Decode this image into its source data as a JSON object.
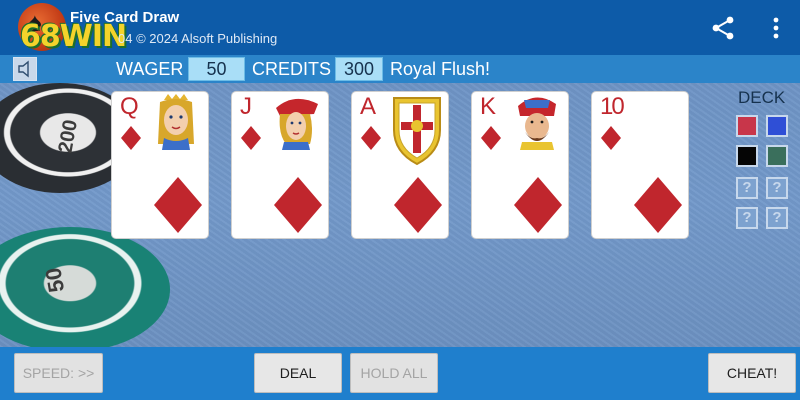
{
  "header": {
    "title": "Five Card Draw",
    "subtitle": "04 © 2024 Alsoft Publishing",
    "brand_watermark": "68WIN",
    "share_icon": "share-icon",
    "menu_icon": "more-vert-icon"
  },
  "info": {
    "sound_icon": "sound-off-icon",
    "wager_label": "WAGER",
    "wager_value": "50",
    "credits_label": "CREDITS",
    "credits_value": "300",
    "status": "Royal Flush!"
  },
  "hand": [
    {
      "rank": "Q",
      "suit": "diamonds",
      "face": "queen"
    },
    {
      "rank": "J",
      "suit": "diamonds",
      "face": "jack"
    },
    {
      "rank": "A",
      "suit": "diamonds",
      "face": "ace-shield"
    },
    {
      "rank": "K",
      "suit": "diamonds",
      "face": "king"
    },
    {
      "rank": "10",
      "suit": "diamonds",
      "face": ""
    }
  ],
  "deck": {
    "label": "DECK",
    "colors": [
      "#c8364a",
      "#2f4fd6",
      "#050505",
      "#3a6f5c"
    ],
    "unknown": [
      "?",
      "?",
      "?",
      "?"
    ]
  },
  "chips": {
    "black_value": "200",
    "green_value": "50"
  },
  "buttons": {
    "speed": "SPEED: >>",
    "deal": "DEAL",
    "hold_all": "HOLD ALL",
    "cheat": "CHEAT!"
  },
  "colors": {
    "app_bar": "#0d5ba8",
    "info_bar": "#2b84c9",
    "table": "#6d93c4",
    "bottom_bar": "#1f7fcd",
    "suit_red": "#c0262d"
  }
}
